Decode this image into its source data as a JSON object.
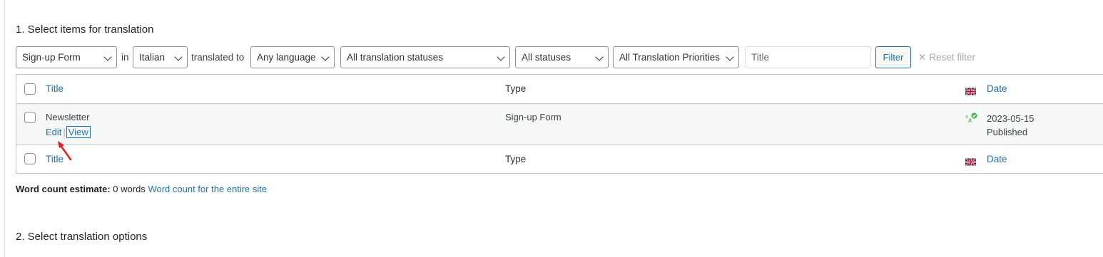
{
  "section1_title": "1. Select items for translation",
  "section2_title": "2. Select translation options",
  "filters": {
    "type_select": "Sign-up Form",
    "in_label": "in",
    "source_lang_select": "Italian",
    "translated_to_label": "translated to",
    "target_lang_select": "Any language",
    "translation_status_select": "All translation statuses",
    "status_select": "All statuses",
    "priority_select": "All Translation Priorities",
    "title_placeholder": "Title",
    "filter_button": "Filter",
    "reset_filter": "Reset filter"
  },
  "table": {
    "header": {
      "title": "Title",
      "type": "Type",
      "date": "Date"
    },
    "rows": [
      {
        "title": "Newsletter",
        "edit": "Edit",
        "view": "View",
        "type": "Sign-up Form",
        "date": "2023-05-15",
        "status": "Published"
      }
    ],
    "footer": {
      "title": "Title",
      "type": "Type",
      "date": "Date"
    }
  },
  "word_count": {
    "label": "Word count estimate:",
    "value": "0 words",
    "link": "Word count for the entire site"
  },
  "colors": {
    "link": "#2271b1",
    "arrow": "#e11d1d",
    "translated_icon": "#46b450"
  }
}
